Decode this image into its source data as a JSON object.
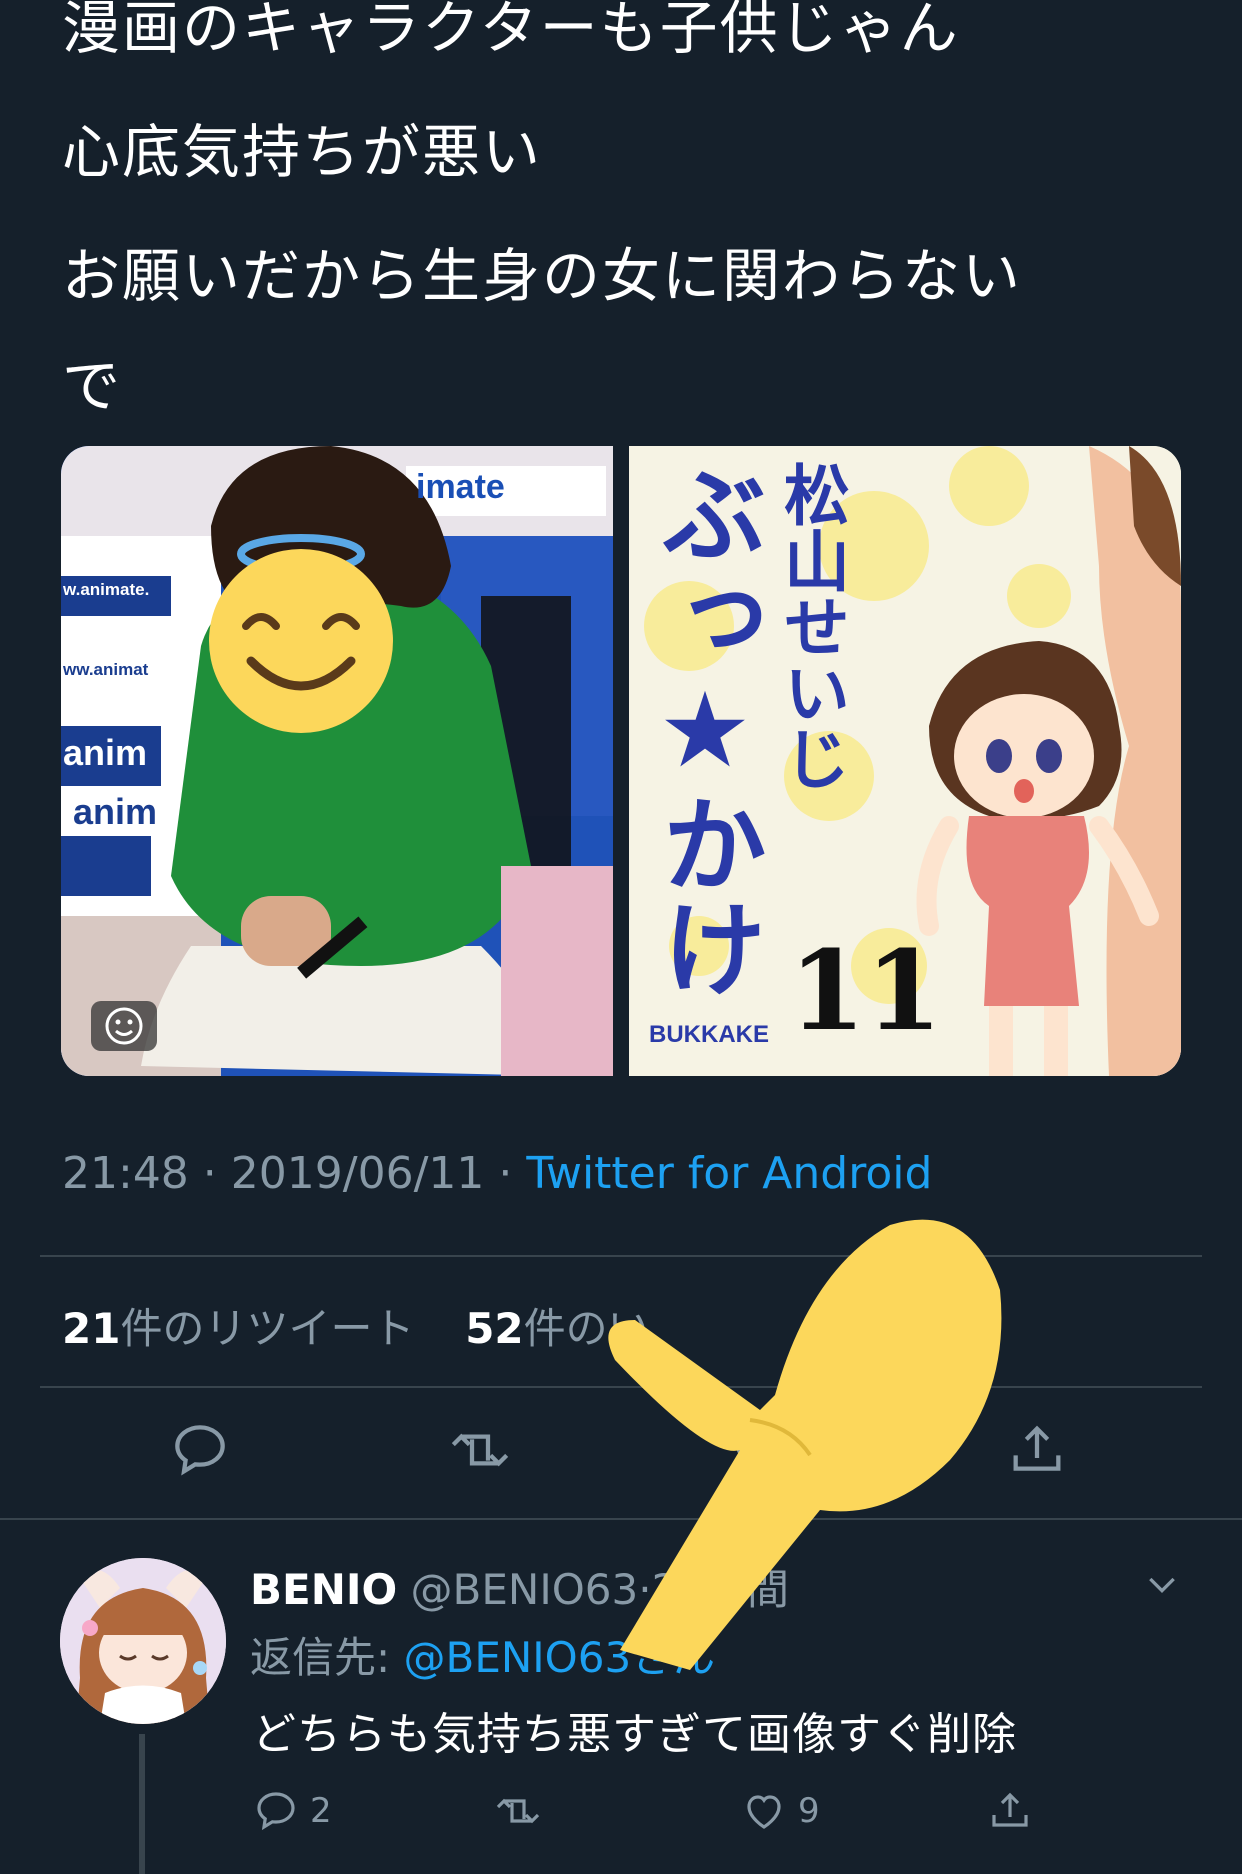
{
  "tweet": {
    "lines": [
      "漫画のキャラクターも子供じゃん",
      "心底気持ちが悪い",
      "お願いだから生身の女に関わらない",
      "で"
    ],
    "media": {
      "left_banner_text": "imate",
      "left_side_texts": [
        "w.animate.",
        "ww.animat",
        "anim",
        "anim"
      ],
      "right_cover_author": "松山せいじ",
      "right_cover_title": "ぶっ★かけ",
      "right_cover_volume": "11",
      "right_cover_romaji": "BUKKAKE"
    },
    "time": "21:48",
    "date": "2019/06/11",
    "separator": " · ",
    "source": "Twitter for Android",
    "retweet_count": "21",
    "retweet_label": "件のリツイート",
    "like_count": "52",
    "like_label": "件のい"
  },
  "reply": {
    "name": "BENIO",
    "handle": "@BENIO63",
    "time": "·21時間",
    "reply_to_label": "返信先: ",
    "reply_to_user": "@BENIO63さん",
    "text": "どちらも気持ち悪すぎて画像すぐ削除",
    "reply_count": "2",
    "like_count": "9"
  },
  "colors": {
    "background": "#15202b",
    "accent": "#1da1f2",
    "secondary_text": "#8899a6",
    "divider": "#38444d",
    "emoji_yellow": "#fcd75b"
  },
  "icons": [
    "reply-icon",
    "retweet-icon",
    "like-icon",
    "share-icon",
    "chevron-down-icon",
    "pointing-hand-emoji"
  ]
}
